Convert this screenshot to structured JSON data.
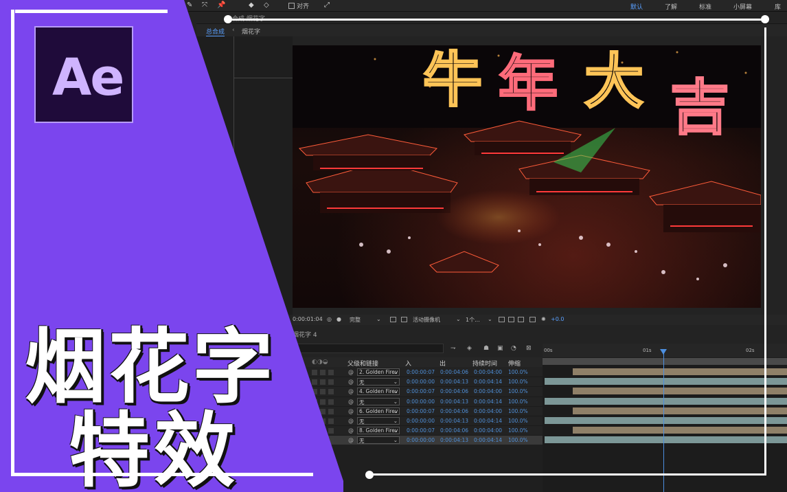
{
  "toolbar": {
    "snap_label": "对齐",
    "workspaces": [
      "默认",
      "了解",
      "标准",
      "小屏幕",
      "库"
    ]
  },
  "comp_tabs": {
    "tab1": "合成 烟花字"
  },
  "breadcrumb": {
    "items": [
      "总合成",
      "烟花字"
    ]
  },
  "viewer": {
    "greeting_chars": [
      "牛",
      "年",
      "大",
      "吉"
    ]
  },
  "viewer_bar": {
    "timecode": "0:00:01:04",
    "quality": "完整",
    "camera": "活动摄像机",
    "views": "1个...",
    "exposure": "+0.0"
  },
  "timeline": {
    "comp_name": "烟花字 4",
    "columns": {
      "parent": "父级和链接",
      "in": "入",
      "out": "出",
      "duration": "持续时间",
      "stretch": "伸缩"
    },
    "layers": [
      {
        "parent": "2. Golden Firev",
        "in": "0:00:00:07",
        "out": "0:00:04:06",
        "dur": "0:00:04:00",
        "stretch": "100.0%"
      },
      {
        "parent": "无",
        "in": "0:00:00:00",
        "out": "0:00:04:13",
        "dur": "0:00:04:14",
        "stretch": "100.0%"
      },
      {
        "parent": "4. Golden Firev",
        "in": "0:00:00:07",
        "out": "0:00:04:06",
        "dur": "0:00:04:00",
        "stretch": "100.0%"
      },
      {
        "parent": "无",
        "in": "0:00:00:00",
        "out": "0:00:04:13",
        "dur": "0:00:04:14",
        "stretch": "100.0%"
      },
      {
        "parent": "6. Golden Firev",
        "in": "0:00:00:07",
        "out": "0:00:04:06",
        "dur": "0:00:04:00",
        "stretch": "100.0%"
      },
      {
        "parent": "无",
        "in": "0:00:00:00",
        "out": "0:00:04:13",
        "dur": "0:00:04:14",
        "stretch": "100.0%"
      },
      {
        "parent": "8. Golden Firev",
        "in": "0:00:00:07",
        "out": "0:00:04:06",
        "dur": "0:00:04:00",
        "stretch": "100.0%"
      },
      {
        "parent": "无",
        "in": "0:00:00:00",
        "out": "0:00:04:13",
        "dur": "0:00:04:14",
        "stretch": "100.0%"
      }
    ],
    "ruler": [
      "00s",
      "01s",
      "02s"
    ]
  },
  "banner": {
    "logo_text": "Ae",
    "title_line1": "烟花字",
    "title_line2": "特效",
    "purple": "#7b45ee"
  }
}
